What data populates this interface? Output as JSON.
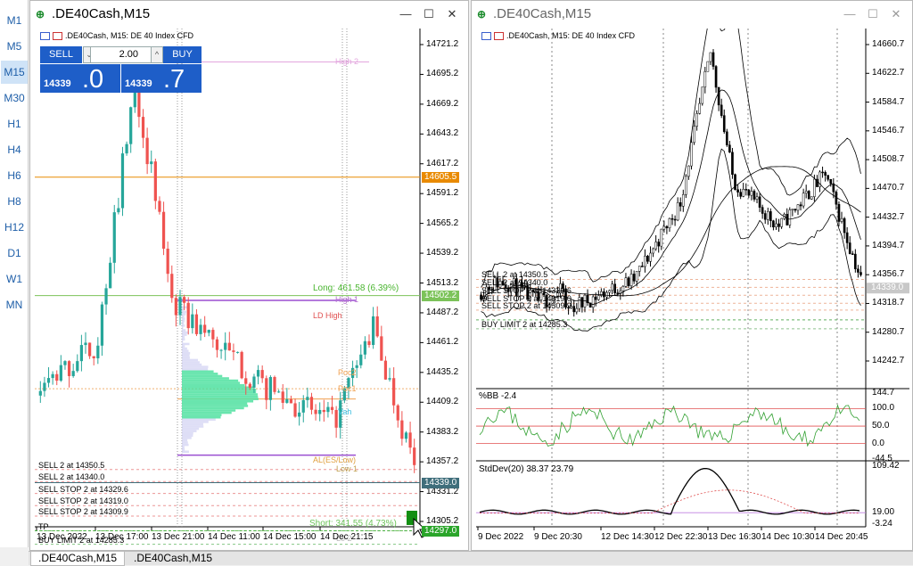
{
  "timeframes": [
    "M1",
    "M5",
    "M15",
    "M30",
    "H1",
    "H4",
    "H6",
    "H8",
    "H12",
    "D1",
    "W1",
    "MN"
  ],
  "active_timeframe": "M15",
  "bottom_tabs": [
    ".DE40Cash,M15",
    ".DE40Cash,M15"
  ],
  "windows": [
    {
      "title": ".DE40Cash,M15",
      "symbol_line": ".DE40Cash, M15:  DE 40 Index CFD",
      "one_click": {
        "sell_label": "SELL",
        "buy_label": "BUY",
        "volume": "2.00",
        "sell_small": "14339",
        "sell_big": ".0",
        "buy_small": "14339",
        "buy_big": ".7",
        "down_arrow": "⌄",
        "up_arrow": "^"
      },
      "price_axis": [
        "14721.2",
        "14695.2",
        "14669.2",
        "14643.2",
        "14617.2",
        "14591.2",
        "14565.2",
        "14539.2",
        "14513.2",
        "14487.2",
        "14461.2",
        "14435.2",
        "14409.2",
        "14383.2",
        "14357.2",
        "14331.2",
        "14305.2"
      ],
      "price_tags": [
        {
          "value": "14605.5",
          "color": "#e98a00"
        },
        {
          "value": "14502.2",
          "color": "#7cc35a"
        },
        {
          "value": "14339.0",
          "color": "#3f6e7b"
        },
        {
          "value": "14297.0",
          "color": "#2aa52a"
        }
      ],
      "trade_labels": [
        {
          "text": "Long: 461.58  (6.39%)",
          "color": "#49b52f"
        },
        {
          "text": "Short: 341.55  (4.73%)",
          "color": "#6dc35a"
        }
      ],
      "level_labels": [
        {
          "text": "High 2",
          "color": "#e3a6de"
        },
        {
          "text": "High 1",
          "color": "#b66fd1"
        },
        {
          "text": "LD High",
          "color": "#e05050"
        },
        {
          "text": "Poc2",
          "color": "#f0a050"
        },
        {
          "text": "Poc1",
          "color": "#f0a050"
        },
        {
          "text": "Vah",
          "color": "#40c0e0"
        },
        {
          "text": "AL(ES/Low)",
          "color": "#e0a040"
        },
        {
          "text": "Low 1",
          "color": "#c0a050"
        },
        {
          "text": "Lo 2",
          "color": "#b8b8b8"
        }
      ],
      "orders": [
        "SELL 2 at 14350.5",
        "SELL 2 at 14340.0",
        "SELL STOP 2 at 14329.6",
        "SELL STOP 2 at 14319.0",
        "SELL STOP 2 at 14309.9",
        "TP",
        "BUY LIMIT 2 at 14285.3"
      ],
      "time_axis": [
        "13 Dec 2022",
        "13 Dec 17:00",
        "13 Dec 21:00",
        "14 Dec 11:00",
        "14 Dec 15:00",
        "14 Dec 21:15"
      ]
    },
    {
      "title": ".DE40Cash,M15",
      "symbol_line": ".DE40Cash, M15:  DE 40 Index CFD",
      "price_axis": [
        "14660.7",
        "14622.7",
        "14584.7",
        "14546.7",
        "14508.7",
        "14470.7",
        "14432.7",
        "14394.7",
        "14356.7",
        "14318.7",
        "14280.7",
        "14242.7"
      ],
      "price_tag": {
        "value": "14339.0",
        "color": "#c8c8c8"
      },
      "orders": [
        "SELL 2 at 14350.5",
        "SELL 2 at 14340.0",
        "SELL STOP 2 at 14329.6",
        "SELL STOP 2 at 14319.0",
        "SELL STOP 2 at 14309.9",
        "BUY LIMIT 2 at 14285.3"
      ],
      "bb_label": "%BB -2.4",
      "bb_axis": [
        "144.7",
        "100.0",
        "50.0",
        "0.0",
        "-44.5"
      ],
      "stddev_label": "StdDev(20) 38.37 23.79",
      "stddev_axis": [
        "109.42",
        "19.00",
        "-3.24"
      ],
      "time_axis": [
        "9 Dec 2022",
        "9 Dec 20:30",
        "12 Dec 14:30",
        "12 Dec 22:30",
        "13 Dec 16:30",
        "14 Dec 10:30",
        "14 Dec 20:45"
      ]
    }
  ]
}
